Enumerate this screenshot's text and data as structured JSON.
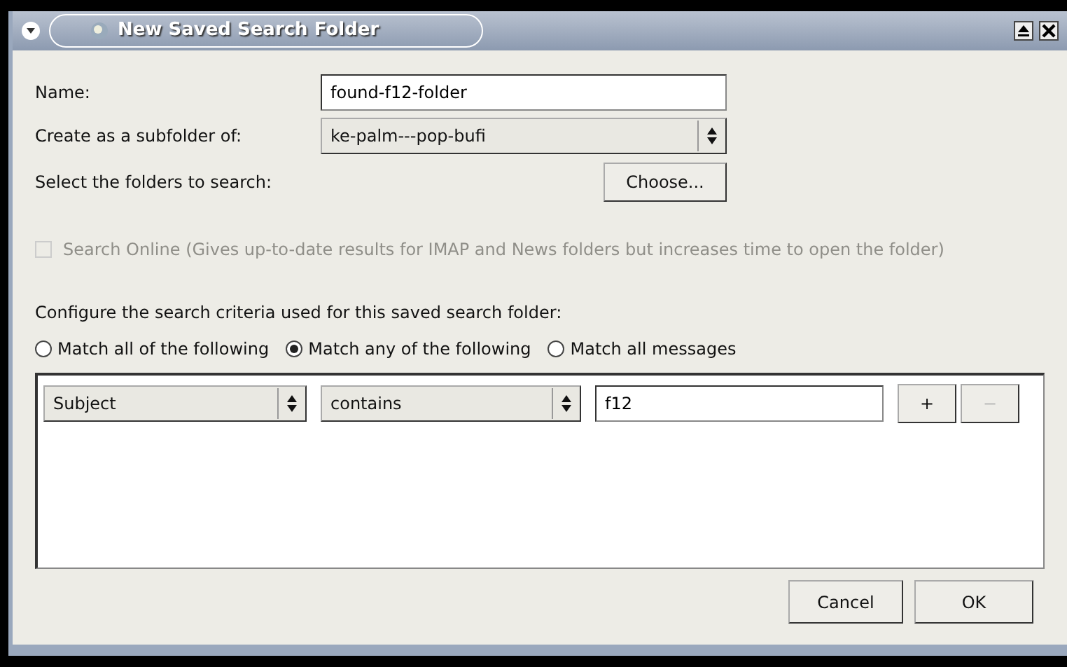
{
  "window": {
    "title": "New Saved Search Folder"
  },
  "name": {
    "label": "Name:",
    "value": "found-f12-folder"
  },
  "subfolder": {
    "label": "Create as a subfolder of:",
    "value": "ke-palm---pop-bufi"
  },
  "folders": {
    "label": "Select the folders to search:",
    "button": "Choose..."
  },
  "search_online": {
    "label": "Search Online (Gives up-to-date results for IMAP and News folders but increases time to open the folder)",
    "checked": false,
    "disabled": true
  },
  "criteria_label": "Configure the search criteria used for this saved search folder:",
  "match_options": [
    {
      "label": "Match all of the following",
      "selected": false
    },
    {
      "label": "Match any of the following",
      "selected": true
    },
    {
      "label": "Match all messages",
      "selected": false
    }
  ],
  "rules": [
    {
      "field": "Subject",
      "operator": "contains",
      "value": "f12",
      "add": "+",
      "remove": "−",
      "remove_disabled": true
    }
  ],
  "buttons": [
    "Cancel",
    "OK"
  ]
}
